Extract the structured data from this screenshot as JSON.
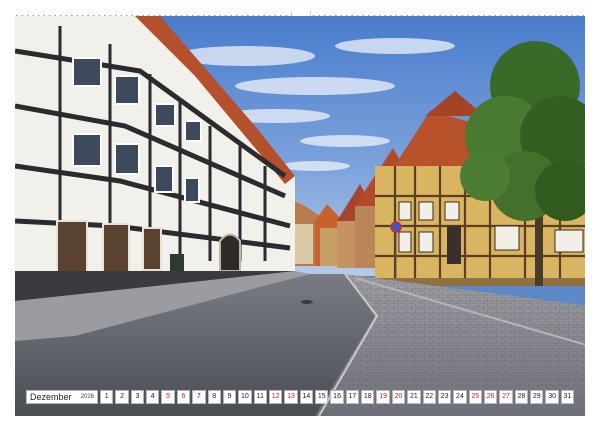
{
  "calendar": {
    "month": "Dezember",
    "year": "2026",
    "days": [
      "1",
      "2",
      "3",
      "4",
      "5",
      "6",
      "7",
      "8",
      "9",
      "10",
      "11",
      "12",
      "13",
      "14",
      "15",
      "16",
      "17",
      "18",
      "19",
      "20",
      "21",
      "22",
      "23",
      "24",
      "25",
      "26",
      "27",
      "28",
      "29",
      "30",
      "31"
    ],
    "red_days": [
      "5",
      "6",
      "12",
      "13",
      "19",
      "20",
      "25",
      "26",
      "27"
    ]
  },
  "photo": {
    "subject": "street-with-half-timbered-houses",
    "colors": {
      "sky": "#5b8ad0",
      "cloud": "#e8eef8",
      "timber_dark": "#2b2a2f",
      "plaster_white": "#f2f0ea",
      "plaster_yellow": "#d9b461",
      "roof_red": "#b8522a",
      "asphalt": "#575a63",
      "cobble": "#8e8d93",
      "tree": "#3f6a2c"
    }
  }
}
